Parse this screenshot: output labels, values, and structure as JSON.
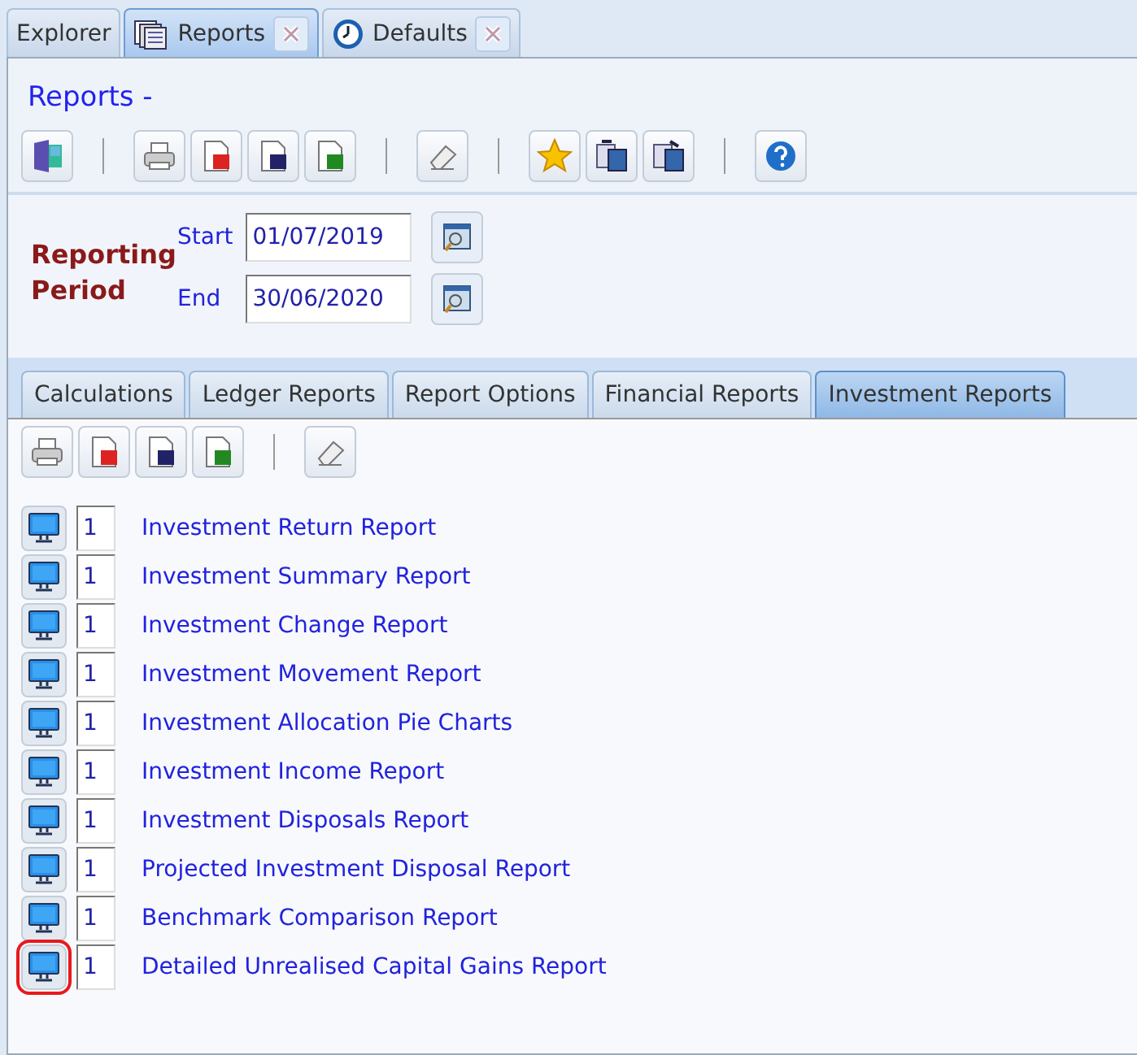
{
  "doc_tabs": [
    {
      "label": "Explorer",
      "kind": "plain",
      "closable": false,
      "selected": false
    },
    {
      "label": "Reports",
      "kind": "reports",
      "closable": true,
      "selected": true
    },
    {
      "label": "Defaults",
      "kind": "settings",
      "closable": true,
      "selected": false
    }
  ],
  "title": "Reports -",
  "toolbar": [
    {
      "kind": "exit"
    },
    {
      "kind": "sep"
    },
    {
      "kind": "print"
    },
    {
      "kind": "pdf"
    },
    {
      "kind": "word"
    },
    {
      "kind": "excel"
    },
    {
      "kind": "sep"
    },
    {
      "kind": "eraser"
    },
    {
      "kind": "sep"
    },
    {
      "kind": "star"
    },
    {
      "kind": "copy"
    },
    {
      "kind": "paste"
    },
    {
      "kind": "sep"
    },
    {
      "kind": "help"
    }
  ],
  "period": {
    "heading": "Reporting Period",
    "start_label": "Start",
    "start": "01/07/2019",
    "end_label": "End",
    "end": "30/06/2020"
  },
  "report_tabs": [
    {
      "label": "Calculations",
      "selected": false
    },
    {
      "label": "Ledger Reports",
      "selected": false
    },
    {
      "label": "Report Options",
      "selected": false
    },
    {
      "label": "Financial Reports",
      "selected": false
    },
    {
      "label": "Investment Reports",
      "selected": true
    }
  ],
  "sub_toolbar": [
    {
      "kind": "print"
    },
    {
      "kind": "pdf"
    },
    {
      "kind": "word"
    },
    {
      "kind": "excel"
    },
    {
      "kind": "sep"
    },
    {
      "kind": "eraser"
    }
  ],
  "reports": [
    {
      "copies": "1",
      "name": "Investment Return Report",
      "highlighted": false
    },
    {
      "copies": "1",
      "name": "Investment Summary Report",
      "highlighted": false
    },
    {
      "copies": "1",
      "name": "Investment Change Report",
      "highlighted": false
    },
    {
      "copies": "1",
      "name": "Investment Movement Report",
      "highlighted": false
    },
    {
      "copies": "1",
      "name": "Investment Allocation Pie Charts",
      "highlighted": false
    },
    {
      "copies": "1",
      "name": "Investment Income Report",
      "highlighted": false
    },
    {
      "copies": "1",
      "name": "Investment Disposals Report",
      "highlighted": false
    },
    {
      "copies": "1",
      "name": "Projected Investment Disposal Report",
      "highlighted": false
    },
    {
      "copies": "1",
      "name": "Benchmark Comparison Report",
      "highlighted": false
    },
    {
      "copies": "1",
      "name": "Detailed Unrealised Capital Gains Report",
      "highlighted": true
    }
  ]
}
